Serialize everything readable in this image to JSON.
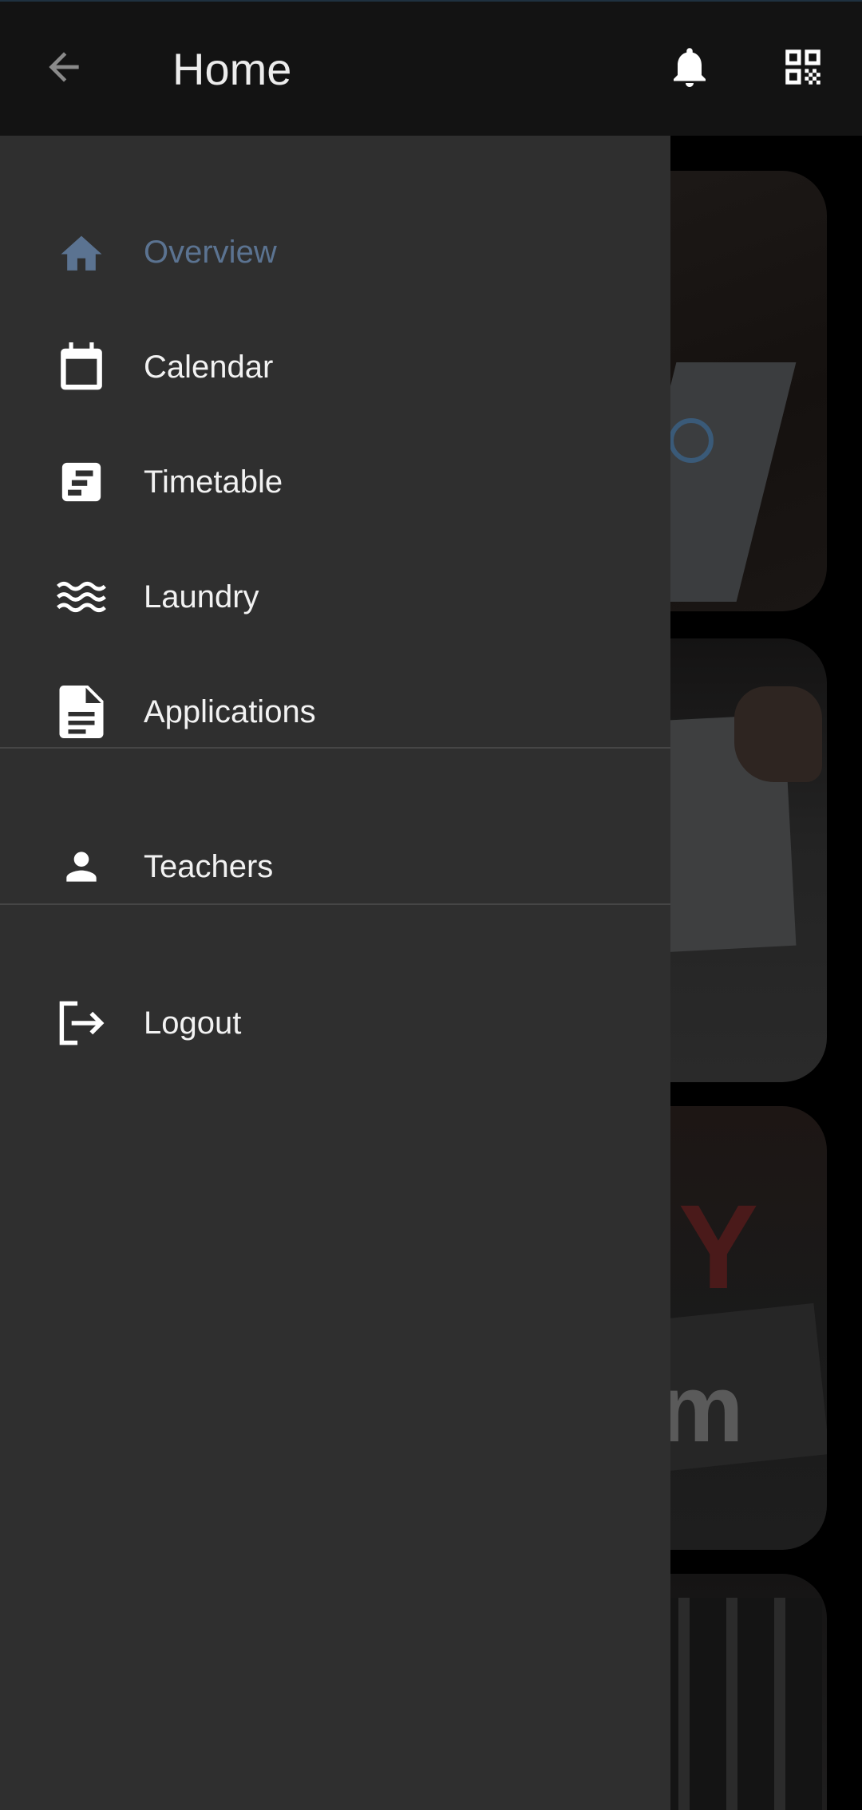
{
  "app_bar": {
    "title": "Home",
    "back_icon": "arrow-left-icon",
    "notification_icon": "bell-icon",
    "qr_icon": "qr-code-icon"
  },
  "drawer": {
    "items": [
      {
        "label": "Overview",
        "icon": "home-icon",
        "active": true
      },
      {
        "label": "Calendar",
        "icon": "calendar-icon",
        "active": false
      },
      {
        "label": "Timetable",
        "icon": "timetable-icon",
        "active": false
      },
      {
        "label": "Laundry",
        "icon": "waves-icon",
        "active": false
      },
      {
        "label": "Applications",
        "icon": "document-icon",
        "active": false
      }
    ],
    "secondary_items": [
      {
        "label": "Teachers",
        "icon": "person-icon"
      }
    ],
    "footer_items": [
      {
        "label": "Logout",
        "icon": "logout-icon"
      }
    ]
  },
  "background": {
    "card3_text": "Y",
    "card3_subtext": "m"
  },
  "colors": {
    "app_bar": "#131313",
    "drawer": "#2f2f2f",
    "active": "#5b7391",
    "text": "#f2f2f2"
  }
}
